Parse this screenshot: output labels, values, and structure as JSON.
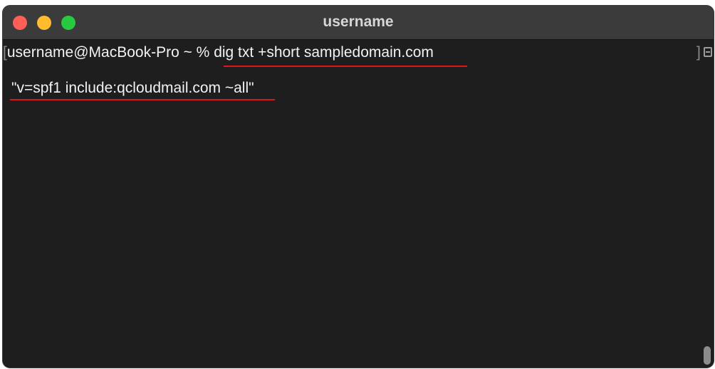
{
  "window": {
    "title": "username"
  },
  "terminal": {
    "prompt_open_bracket": "[",
    "prompt": "username@MacBook-Pro ~ % ",
    "command": "dig txt +short sampledomain.com",
    "output": "\"v=spf1 include:qcloudmail.com ~all\"",
    "prompt_close_bracket": "]"
  },
  "icons": {
    "close": "close-icon",
    "minimize": "minimize-icon",
    "zoom": "zoom-icon",
    "menu": "menu-icon"
  },
  "colors": {
    "background": "#1e1e1e",
    "titlebar": "#3b3b3b",
    "text": "#f2f2f2",
    "underline": "#e2141b",
    "close": "#ff5f57",
    "minimize": "#febc2e",
    "zoom": "#28c840"
  }
}
